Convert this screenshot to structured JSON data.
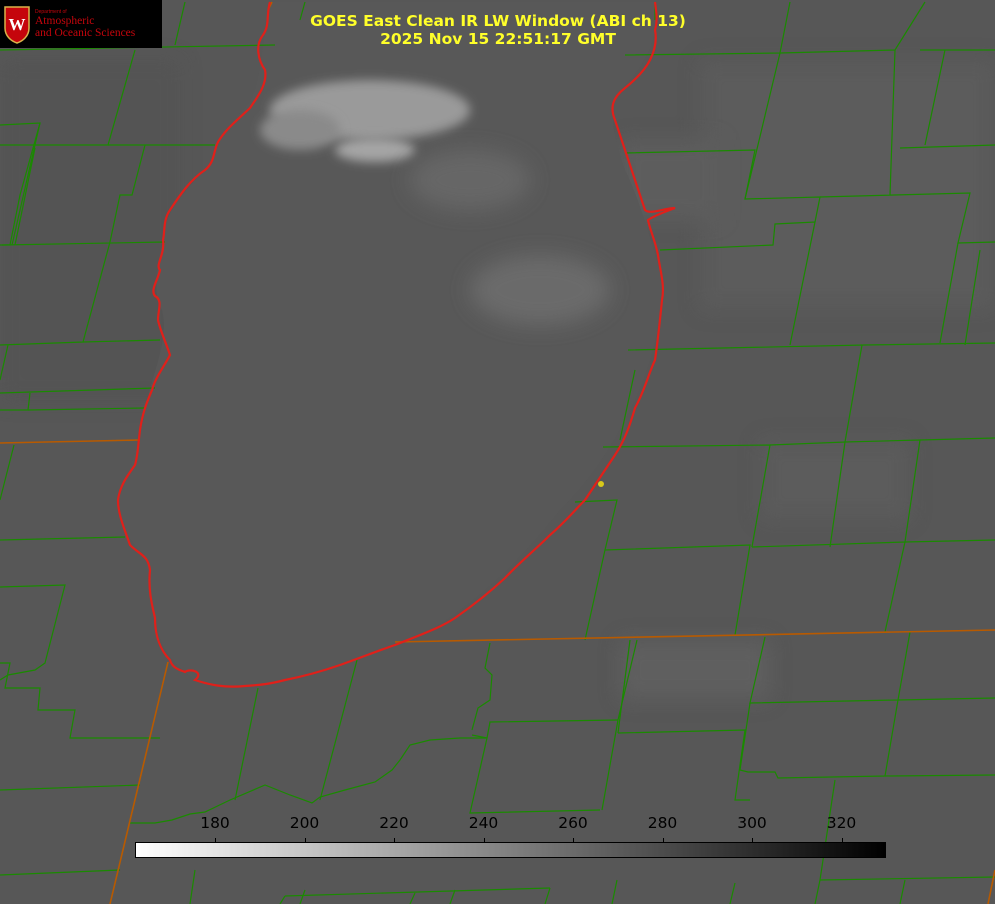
{
  "header": {
    "line1": "GOES East Clean IR LW Window (ABI ch 13)",
    "line2": "2025 Nov 15 22:51:17 GMT"
  },
  "logo": {
    "dept": "Department of",
    "name_line1": "Atmospheric",
    "name_line2": "and Oceanic Sciences",
    "crest_letter": "W"
  },
  "colorbar": {
    "ticks": [
      "180",
      "200",
      "220",
      "240",
      "260",
      "280",
      "300",
      "320"
    ],
    "min_color": "#ffffff",
    "max_color": "#000000"
  },
  "colors": {
    "background": "#565656",
    "county_lines": "#1a8a00",
    "state_lines": "#b85a00",
    "lake_outline": "#e0201a",
    "title_text": "#ffff2a"
  }
}
